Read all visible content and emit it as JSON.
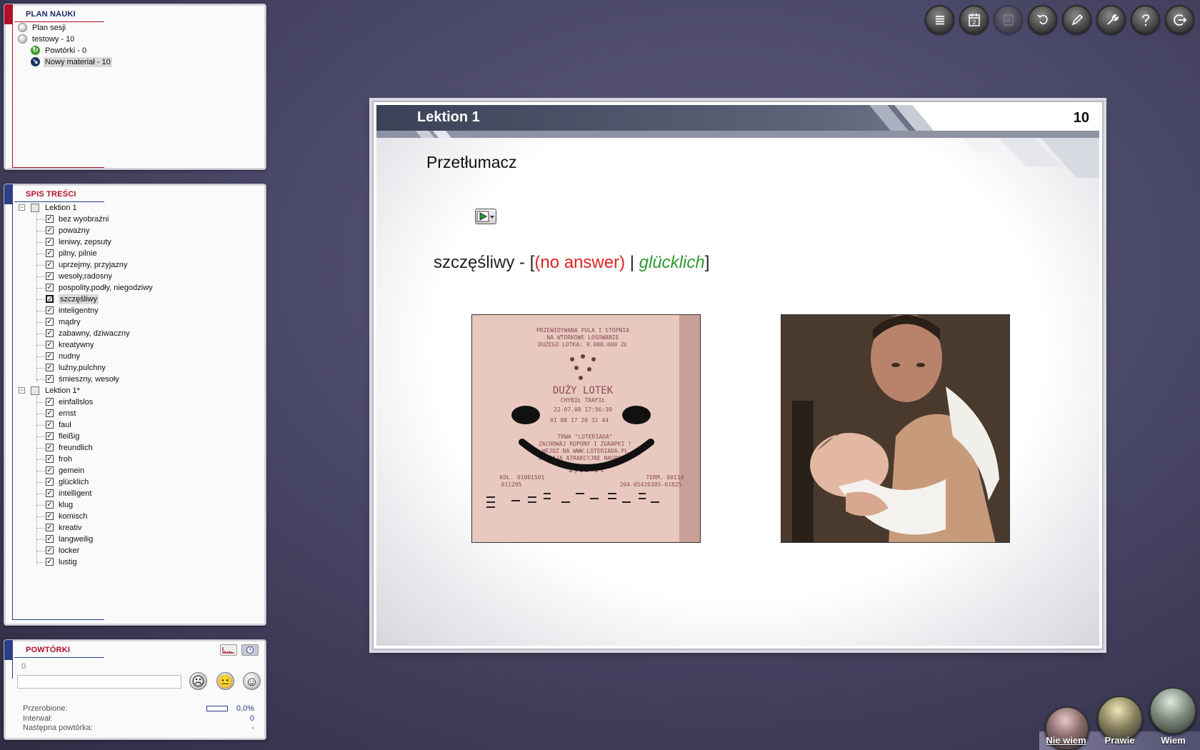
{
  "plan": {
    "title": "PLAN NAUKI",
    "items": [
      {
        "label": "Plan sesji"
      },
      {
        "label": "testowy - 10"
      },
      {
        "label": "Powtórki - 0"
      },
      {
        "label": "Nowy materiał - 10"
      }
    ]
  },
  "spis": {
    "title": "SPIS TREŚCI",
    "lekcja1": {
      "label": "Lektion 1",
      "items": [
        "bez wyobraźni",
        "poważny",
        "leniwy, zepsuty",
        "pilny, pilnie",
        "uprzejmy, przyjazny",
        "wesoły,radosny",
        "pospolity,podły, niegodziwy",
        "szczęśliwy",
        "inteligentny",
        "mądry",
        "zabawny, dziwaczny",
        "kreatywny",
        "nudny",
        "luźny,pulchny",
        "śmieszny, wesoły"
      ]
    },
    "lekcja2": {
      "label": "Lektion 1*",
      "items": [
        "einfallslos",
        "ernst",
        "faul",
        "fleißig",
        "freundlich",
        "froh",
        "gemein",
        "glücklich",
        "intelligent",
        "klug",
        "komisch",
        "kreativ",
        "langweilig",
        "locker",
        "lustig"
      ]
    },
    "selected": "szczęśliwy"
  },
  "powtorki": {
    "title": "POWTÓRKI",
    "count": "0",
    "stats": [
      {
        "label": "Przerobione:",
        "value": "0,0%"
      },
      {
        "label": "Interwał:",
        "value": "0"
      },
      {
        "label": "Następna powtórka:",
        "value": "-"
      }
    ],
    "progress": 0.0
  },
  "toolbar": {
    "icons": [
      "list-icon",
      "calendar-icon",
      "font-icon",
      "mouse-icon",
      "pencil-icon",
      "wrench-icon",
      "help-icon",
      "exit-icon"
    ]
  },
  "card": {
    "lesson_title": "Lektion 1",
    "number": "10",
    "heading": "Przetłumacz",
    "question": "szczęśliwy -",
    "bracket_open": "[",
    "no_answer": "(no answer)",
    "separator": "|",
    "correct": "glücklich",
    "bracket_close": "]",
    "ticket_text": {
      "line1": "PRZEWIDYWANA PULA I STOPNIA",
      "line2": "NA WTORKOWE LOSOWANIE",
      "line3": "DUŻEGO LOTKA: 9.000.000 ZŁ",
      "brand": "DUŻY LOTEK",
      "sub": "CHYBIŁ TRAFIŁ",
      "date": "22.07.08   17:56:39",
      "code": "01 08 17 20 32 44",
      "promo1": "TRWA \"LOTERIADA\"",
      "promo2": "ZACHOWAJ KUPONY I ZGRAPKI !",
      "promo3": "WEJDŹ NA WWW.LOTERIADA.PL",
      "promo4": "CZEKAJĄ ATRAKCYJNE NAGRODY!",
      "price": "2,00 zł",
      "kol": "KOL. 01001501",
      "term": "TERM. 00114",
      "num1": "011295",
      "num2": "204-0542038S-01825"
    }
  },
  "answers": [
    {
      "label": "Nie wiem"
    },
    {
      "label": "Prawie"
    },
    {
      "label": "Wiem"
    }
  ]
}
